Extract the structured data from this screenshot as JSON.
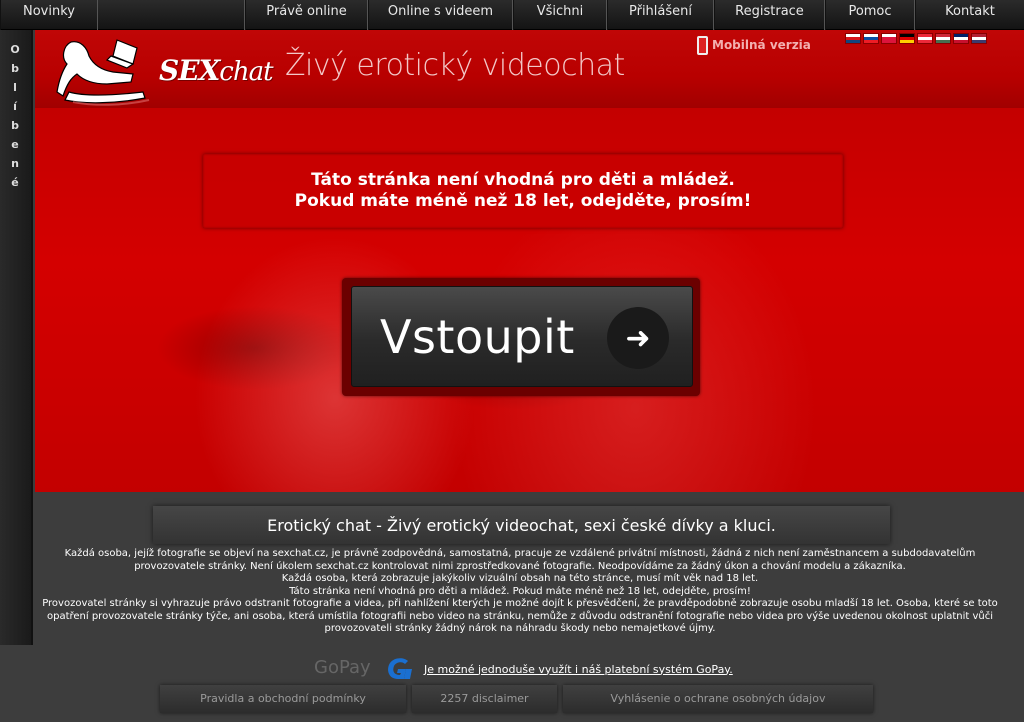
{
  "nav": {
    "items": [
      {
        "label": "Novinky"
      },
      {
        "label": "Právě online"
      },
      {
        "label": "Online s videem"
      },
      {
        "label": "Všichni"
      },
      {
        "label": "Přihlášení"
      },
      {
        "label": "Registrace"
      },
      {
        "label": "Pomoc"
      },
      {
        "label": "Kontakt"
      }
    ]
  },
  "favorites": {
    "letters": [
      "O",
      "b",
      "l",
      "í",
      "b",
      "e",
      "n",
      "é"
    ]
  },
  "header": {
    "logo_text_sex": "SEX",
    "logo_text_chat": "chat",
    "tagline": "Živý erotický videochat",
    "mobile_label": "Mobilná verzia",
    "flags": [
      {
        "name": "flag-cz-icon",
        "colors": [
          "#ffffff",
          "#d7141a",
          "#11457e"
        ]
      },
      {
        "name": "flag-sk-icon",
        "colors": [
          "#ffffff",
          "#0b4ea2",
          "#ee1c25"
        ]
      },
      {
        "name": "flag-pl-icon",
        "colors": [
          "#ffffff",
          "#dc143c",
          "#dc143c"
        ]
      },
      {
        "name": "flag-de-icon",
        "colors": [
          "#000000",
          "#dd0000",
          "#ffce00"
        ]
      },
      {
        "name": "flag-at-icon",
        "colors": [
          "#ed2939",
          "#ffffff",
          "#ed2939"
        ]
      },
      {
        "name": "flag-hu-icon",
        "colors": [
          "#ce2939",
          "#ffffff",
          "#477050"
        ]
      },
      {
        "name": "flag-uk-icon",
        "colors": [
          "#012169",
          "#ffffff",
          "#c8102e"
        ]
      },
      {
        "name": "flag-us-icon",
        "colors": [
          "#b22234",
          "#ffffff",
          "#3c3b6e"
        ]
      }
    ]
  },
  "hero": {
    "warning_line1": "Táto stránka není vhodná pro děti a mládež.",
    "warning_line2": "Pokud máte méně než 18 let, odejděte, prosím!",
    "enter_label": "Vstoupit",
    "enter_icon": "arrow-right-icon"
  },
  "bottom": {
    "title": "Erotický chat - Živý erotický videochat, sexi české dívky a kluci.",
    "disclaimer_lines": [
      "Každá osoba, jejíž fotografie se objeví na sexchat.cz, je právně zodpovědná, samostatná, pracuje ze vzdálené privátní místnosti, žádná z nich není zaměstnancem a subdodavatelům provozovatele stránky. Není úkolem sexchat.cz kontrolovat nimi zprostředkované fotografie. Neodpovídáme za žádný úkon a chování modelu a zákazníka.",
      "Každá osoba, která zobrazuje jakýkoliv vizuální obsah na této stránce, musí mít věk nad 18 let.",
      "Táto stránka není vhodná pro děti a mládež. Pokud máte méně než 18 let, odejděte, prosím!",
      "Provozovatel stránky si vyhrazuje právo odstranit fotografie a videa, při nahlížení kterých je možné dojít k přesvědčení, že pravděpodobně zobrazuje osobu mladší 18 let. Osoba, které se toto opatření provozovatele stránky týče, ani osoba, která umístila fotografii nebo video na stránku, nemůže z důvodu odstranění fotografie nebo videa pro výše uvedenou okolnost uplatnit vůči provozovateli stránky žádný nárok na náhradu škody nebo nemajetkové újmy."
    ],
    "gopay_logo": "GoPay",
    "gopay_text": "Je možné jednoduše využít i náš platební systém GoPay.",
    "footer_links": [
      {
        "label": "Pravidla a obchodní podmínky"
      },
      {
        "label": "2257 disclaimer"
      },
      {
        "label": "Vyhlásenie o ochrane osobných údajov"
      }
    ]
  }
}
